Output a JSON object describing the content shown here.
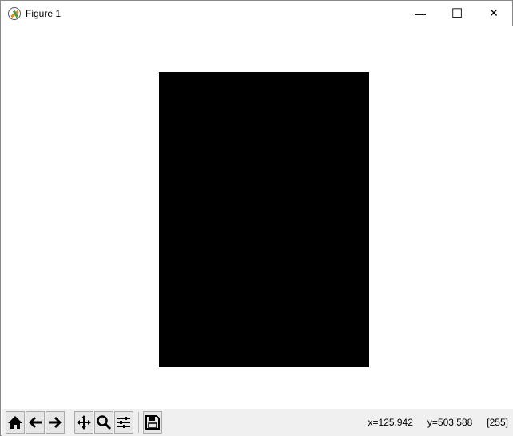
{
  "window": {
    "title": "Figure 1",
    "controls": {
      "minimize": "—",
      "maximize": "☐",
      "close": "✕"
    }
  },
  "image": {
    "fill_color": "#000000",
    "pixel_value": 255
  },
  "toolbar": {
    "buttons": [
      "home",
      "back",
      "forward",
      "pan",
      "zoom",
      "configure-subplots",
      "save"
    ]
  },
  "status": {
    "x": "x=125.942",
    "y": "y=503.588",
    "value": "[255]"
  }
}
